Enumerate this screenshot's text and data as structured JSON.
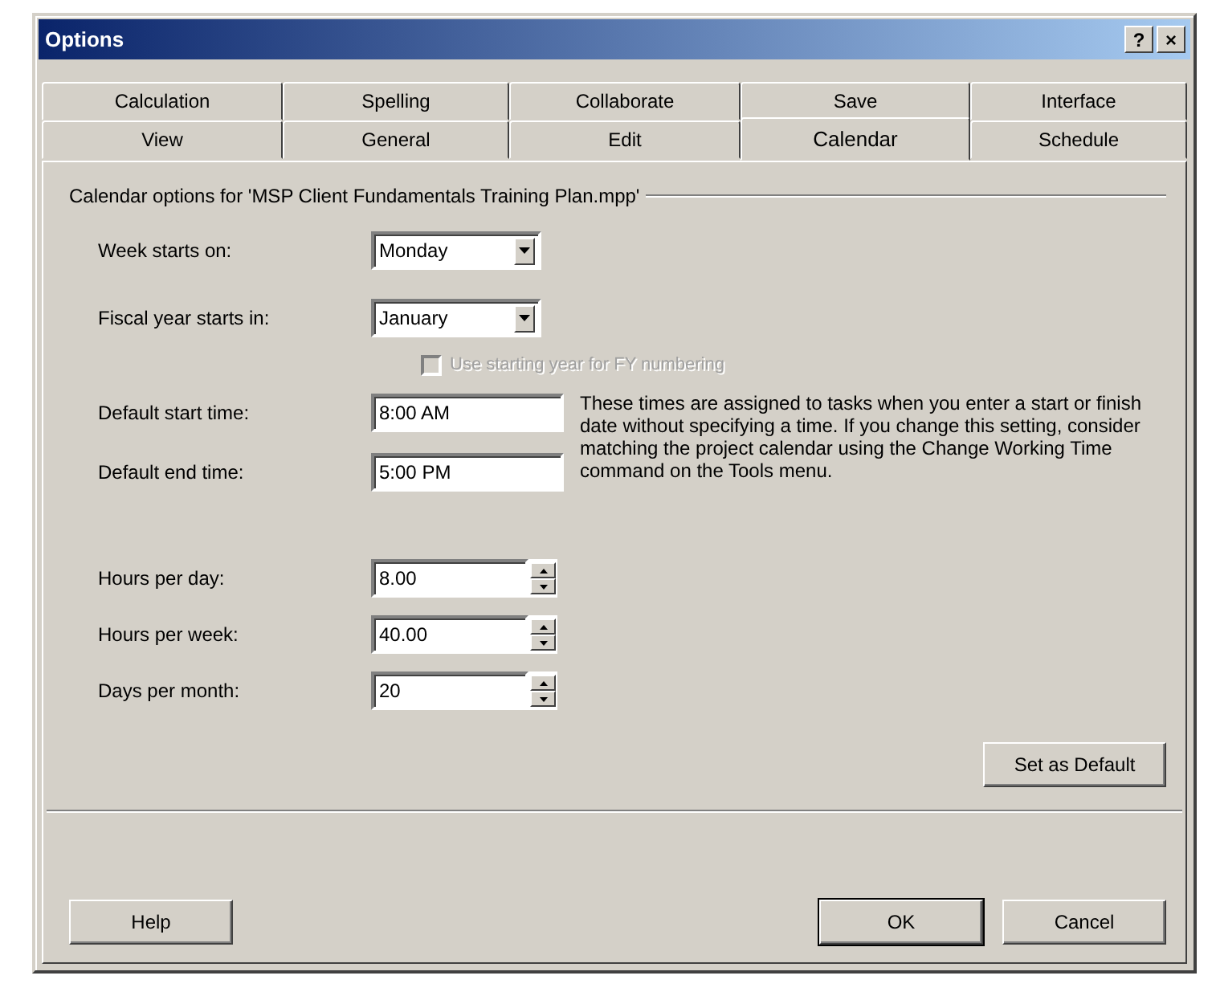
{
  "window": {
    "title": "Options",
    "help_button": "?",
    "close_button": "×"
  },
  "tab_rows": [
    {
      "tabs": [
        {
          "label": "Calculation",
          "selected": false
        },
        {
          "label": "Spelling",
          "selected": false
        },
        {
          "label": "Collaborate",
          "selected": false
        },
        {
          "label": "Save",
          "selected": false
        },
        {
          "label": "Interface",
          "selected": false
        }
      ]
    },
    {
      "tabs": [
        {
          "label": "View",
          "selected": false
        },
        {
          "label": "General",
          "selected": false
        },
        {
          "label": "Edit",
          "selected": false
        },
        {
          "label": "Calendar",
          "selected": true
        },
        {
          "label": "Schedule",
          "selected": false
        }
      ]
    }
  ],
  "group_title": "Calendar options for 'MSP Client Fundamentals Training Plan.mpp'",
  "week_fields": [
    {
      "kind": "select",
      "label": "Week starts on:",
      "value": "Monday"
    },
    {
      "kind": "select",
      "label": "Fiscal year starts in:",
      "value": "January"
    }
  ],
  "fy_checkbox": {
    "label": "Use starting year for FY numbering",
    "checked": false,
    "disabled": true
  },
  "time_fields": [
    {
      "kind": "text",
      "label": "Default start time:",
      "value": "8:00 AM"
    },
    {
      "kind": "text",
      "label": "Default end time:",
      "value": "5:00 PM"
    }
  ],
  "time_note": "These times are assigned to tasks when you enter a start or finish date without specifying a time. If you change this setting, consider matching the project calendar using the Change Working Time command on the Tools menu.",
  "hour_fields": [
    {
      "kind": "spin",
      "label": "Hours per day:",
      "value": "8.00"
    },
    {
      "kind": "spin",
      "label": "Hours per week:",
      "value": "40.00"
    },
    {
      "kind": "spin",
      "label": "Days per month:",
      "value": "20"
    }
  ],
  "set_default_button": "Set as Default",
  "buttons": [
    {
      "label": "Help",
      "default": false
    },
    {
      "label": "OK",
      "default": true
    },
    {
      "label": "Cancel",
      "default": false
    }
  ]
}
